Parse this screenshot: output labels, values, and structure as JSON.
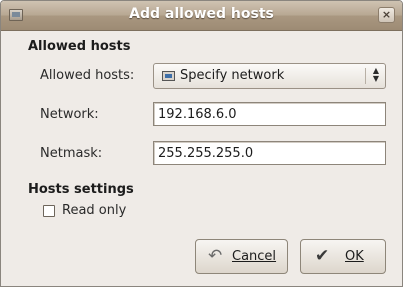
{
  "window": {
    "title": "Add allowed hosts",
    "close_glyph": "×"
  },
  "allowed_hosts": {
    "section_title": "Allowed hosts",
    "allowed_label": "Allowed hosts:",
    "allowed_value": "Specify network",
    "allowed_icon": "network-icon",
    "network_label": "Network:",
    "network_value": "192.168.6.0",
    "netmask_label": "Netmask:",
    "netmask_value": "255.255.255.0"
  },
  "hosts_settings": {
    "section_title": "Hosts settings",
    "read_only_label": "Read only",
    "read_only_checked": false
  },
  "buttons": {
    "cancel_label": "Cancel",
    "cancel_icon": "cancel-icon",
    "ok_label": "OK",
    "ok_icon": "ok-icon"
  }
}
